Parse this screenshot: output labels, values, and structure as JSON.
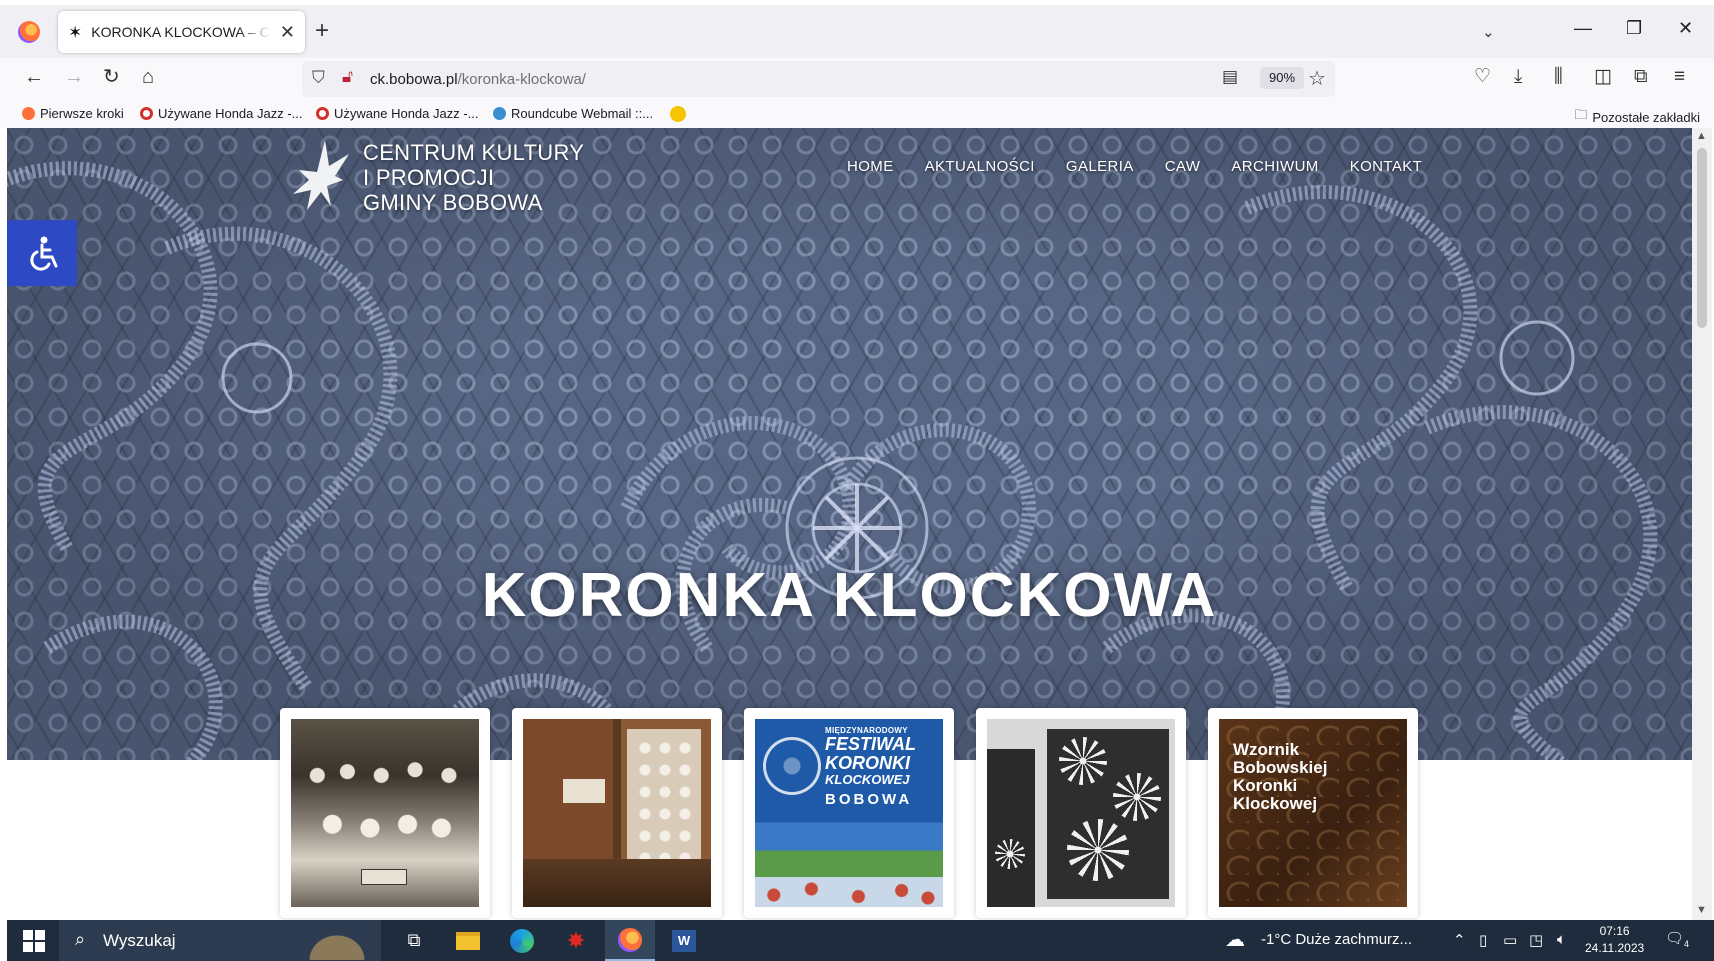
{
  "browser": {
    "tab_title": "KORONKA KLOCKOWA – Centrum Kultury",
    "new_tab": "+",
    "url_domain": "ck.bobowa.pl",
    "url_path": "/koronka-klockowa/",
    "zoom": "90%"
  },
  "bookmarks": [
    {
      "label": "Pierwsze kroki",
      "color": "#ff7139"
    },
    {
      "label": "Używane Honda Jazz -...",
      "color": "#d32f2f"
    },
    {
      "label": "Używane Honda Jazz -...",
      "color": "#d32f2f"
    },
    {
      "label": "Roundcube Webmail ::...",
      "color": "#3b8fd0"
    }
  ],
  "bookmarks_other": "Pozostałe zakładki",
  "site": {
    "logo_lines": [
      "CENTRUM KULTURY",
      "I PROMOCJI",
      "GMINY BOBOWA"
    ],
    "menu": [
      "HOME",
      "AKTUALNOŚCI",
      "GALERIA",
      "CAW",
      "ARCHIWUM",
      "KONTAKT"
    ],
    "hero_title": "KORONKA KLOCKOWA",
    "card3": {
      "line1": "MIĘDZYNARODOWY",
      "line2": "FESTIWAL",
      "line3": "KORONKI",
      "line4": "KLOCKOWEJ",
      "line5": "BOBOWA"
    },
    "card5": {
      "line1": "Wzornik",
      "line2": "Bobowskiej",
      "line3": "Koronki",
      "line4": "Klockowej"
    }
  },
  "taskbar": {
    "search_placeholder": "Wyszukaj",
    "weather": "-1°C  Duże zachmurz...",
    "time": "07:16",
    "date": "24.11.2023",
    "notifications": "4"
  },
  "colors": {
    "accessibility_button": "#2e49c4",
    "taskbar": "#1f2c3d",
    "hero_tint": "#5a6a8a"
  }
}
